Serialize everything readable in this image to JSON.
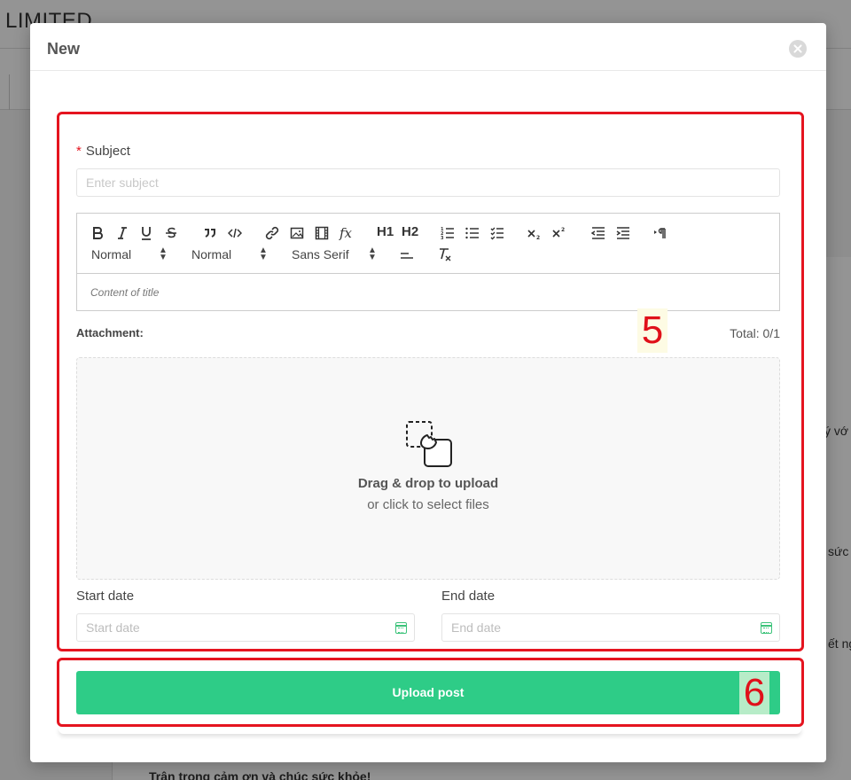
{
  "background": {
    "title": "LIMITED",
    "snippets": [
      "ý vớ",
      "sức",
      "ết ng"
    ],
    "footer_text": "Trân trọng cảm ơn và chúc sức khỏe!"
  },
  "modal": {
    "title": "New",
    "subject": {
      "label": "Subject",
      "required_mark": "*",
      "placeholder": "Enter subject"
    },
    "editor": {
      "pickers": {
        "size": "Normal",
        "header": "Normal",
        "font": "Sans Serif"
      },
      "toolbar_labels": {
        "h1": "H1",
        "h2": "H2"
      },
      "placeholder": "Content of title"
    },
    "attachment": {
      "label": "Attachment:",
      "total": "Total: 0/1",
      "drop_title": "Drag & drop to upload",
      "drop_sub": "or click to select files"
    },
    "start_date": {
      "label": "Start date",
      "placeholder": "Start date"
    },
    "end_date": {
      "label": "End date",
      "placeholder": "End date"
    },
    "submit_label": "Upload post",
    "annotations": {
      "form_section": "5",
      "submit_section": "6"
    }
  },
  "colors": {
    "accent_green": "#2ecc87",
    "annotation_red": "#e5141f",
    "calendar_green": "#3cc37a"
  },
  "icons": [
    "close-icon",
    "bold-icon",
    "italic-icon",
    "underline-icon",
    "strike-icon",
    "blockquote-icon",
    "code-block-icon",
    "link-icon",
    "image-icon",
    "video-icon",
    "formula-icon",
    "ordered-list-icon",
    "bullet-list-icon",
    "check-list-icon",
    "subscript-icon",
    "superscript-icon",
    "outdent-icon",
    "indent-icon",
    "text-direction-icon",
    "align-icon",
    "clear-format-icon",
    "drag-drop-upload-icon",
    "calendar-icon"
  ]
}
